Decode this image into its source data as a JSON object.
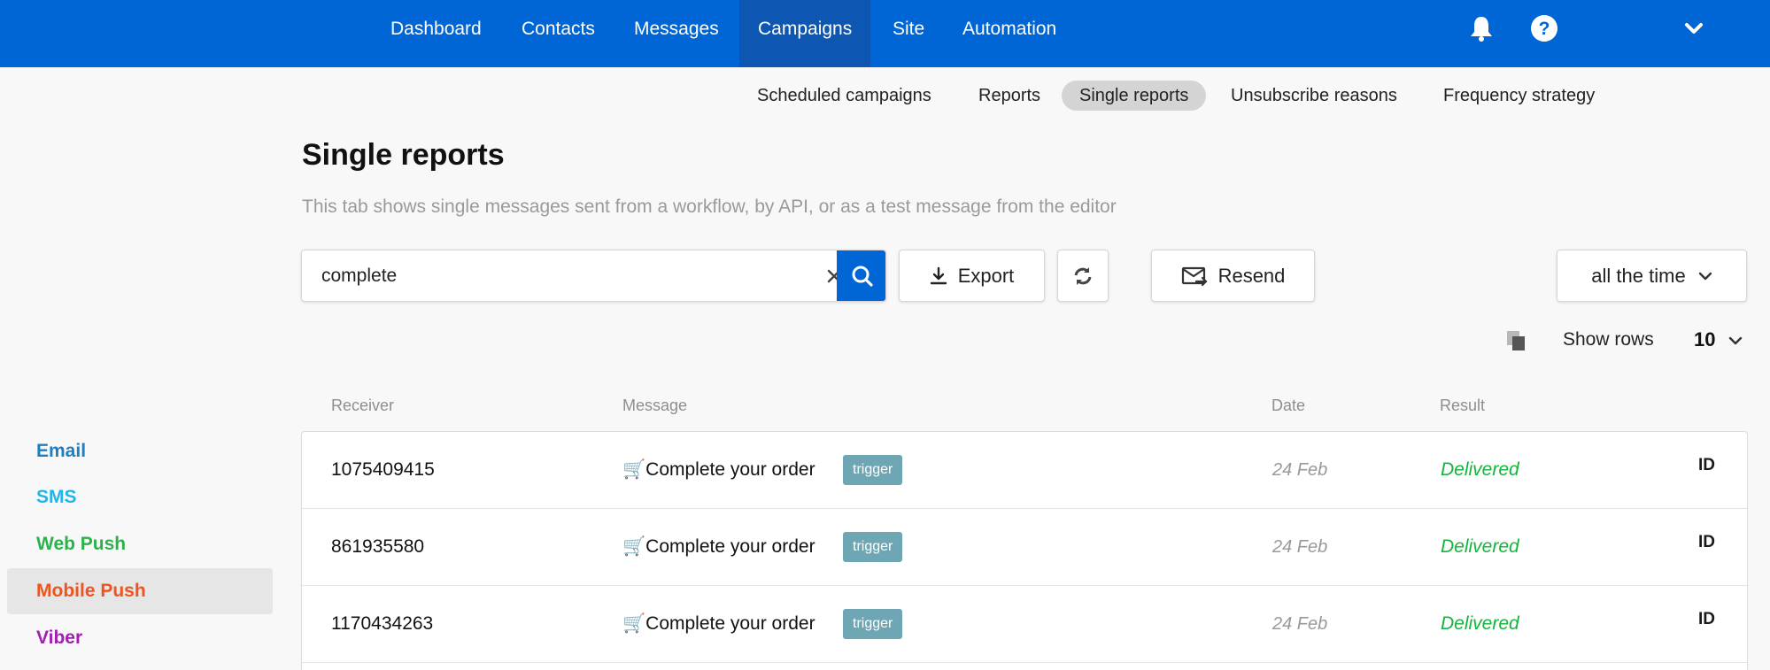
{
  "topnav": {
    "items": [
      {
        "label": "Dashboard"
      },
      {
        "label": "Contacts"
      },
      {
        "label": "Messages"
      },
      {
        "label": "Campaigns",
        "active": true
      },
      {
        "label": "Site"
      },
      {
        "label": "Automation"
      }
    ],
    "icons": [
      "bell-icon",
      "help-icon",
      "chevron-down-icon"
    ]
  },
  "subnav": {
    "items": [
      {
        "label": "Scheduled campaigns"
      },
      {
        "label": "Reports"
      },
      {
        "label": "Single reports",
        "active": true
      },
      {
        "label": "Unsubscribe reasons"
      },
      {
        "label": "Frequency strategy"
      }
    ]
  },
  "page": {
    "title": "Single reports",
    "description": "This tab shows single messages sent from a workflow, by API, or as a test message from the editor"
  },
  "toolbar": {
    "search_value": "complete",
    "export_label": "Export",
    "resend_label": "Resend",
    "period_label": "all the time",
    "show_rows_label": "Show rows",
    "show_rows_value": "10"
  },
  "sidebar": {
    "items": [
      {
        "label": "Email",
        "color": "#1b7fc4"
      },
      {
        "label": "SMS",
        "color": "#1fb6e8"
      },
      {
        "label": "Web Push",
        "color": "#2bb24c"
      },
      {
        "label": "Mobile Push",
        "color": "#f0541e",
        "active": true
      },
      {
        "label": "Viber",
        "color": "#a020b0"
      }
    ]
  },
  "table": {
    "columns": [
      "Receiver",
      "Message",
      "Date",
      "Result"
    ],
    "rows": [
      {
        "receiver": "1075409415",
        "message": "🛒Complete your order",
        "tag": "trigger",
        "date": "24 Feb",
        "result": "Delivered",
        "id": "ID"
      },
      {
        "receiver": "861935580",
        "message": "🛒Complete your order",
        "tag": "trigger",
        "date": "24 Feb",
        "result": "Delivered",
        "id": "ID"
      },
      {
        "receiver": "1170434263",
        "message": "🛒Complete your order",
        "tag": "trigger",
        "date": "24 Feb",
        "result": "Delivered",
        "id": "ID"
      }
    ]
  },
  "colors": {
    "brand": "#0066d6",
    "delivered": "#14b53c",
    "trigger_tag": "#6fa6b3"
  }
}
